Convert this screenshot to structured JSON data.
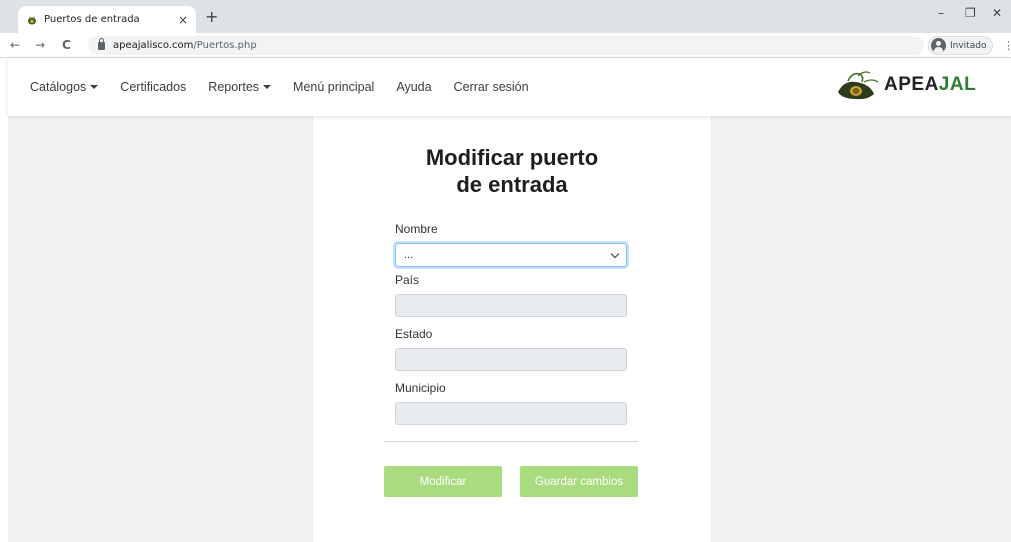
{
  "browser": {
    "tab_title": "Puertos de entrada",
    "tab_close": "×",
    "new_tab": "+",
    "url_host": "apeajalisco.com",
    "url_path": "/Puertos.php",
    "profile_label": "Invitado",
    "back": "←",
    "forward": "→",
    "reload": "C",
    "minimize": "–",
    "restore": "❐",
    "close": "✕",
    "menu": "⋮"
  },
  "navbar": {
    "items": [
      {
        "label": "Catálogos",
        "dropdown": true
      },
      {
        "label": "Certificados",
        "dropdown": false
      },
      {
        "label": "Reportes",
        "dropdown": true
      },
      {
        "label": "Menú principal",
        "dropdown": false
      },
      {
        "label": "Ayuda",
        "dropdown": false
      },
      {
        "label": "Cerrar sesión",
        "dropdown": false
      }
    ],
    "logo": {
      "text_main": "APEA",
      "text_accent": "JAL",
      "accent_color": "#2e7d32"
    }
  },
  "form": {
    "title_line1": "Modificar puerto",
    "title_line2": "de entrada",
    "nombre_label": "Nombre",
    "nombre_value": "...",
    "pais_label": "País",
    "pais_value": "",
    "estado_label": "Estado",
    "estado_value": "",
    "municipio_label": "Municipio",
    "municipio_value": ""
  },
  "buttons": {
    "modificar": "Modificar",
    "guardar": "Guardar cambios",
    "color": "#a8dc7f"
  }
}
